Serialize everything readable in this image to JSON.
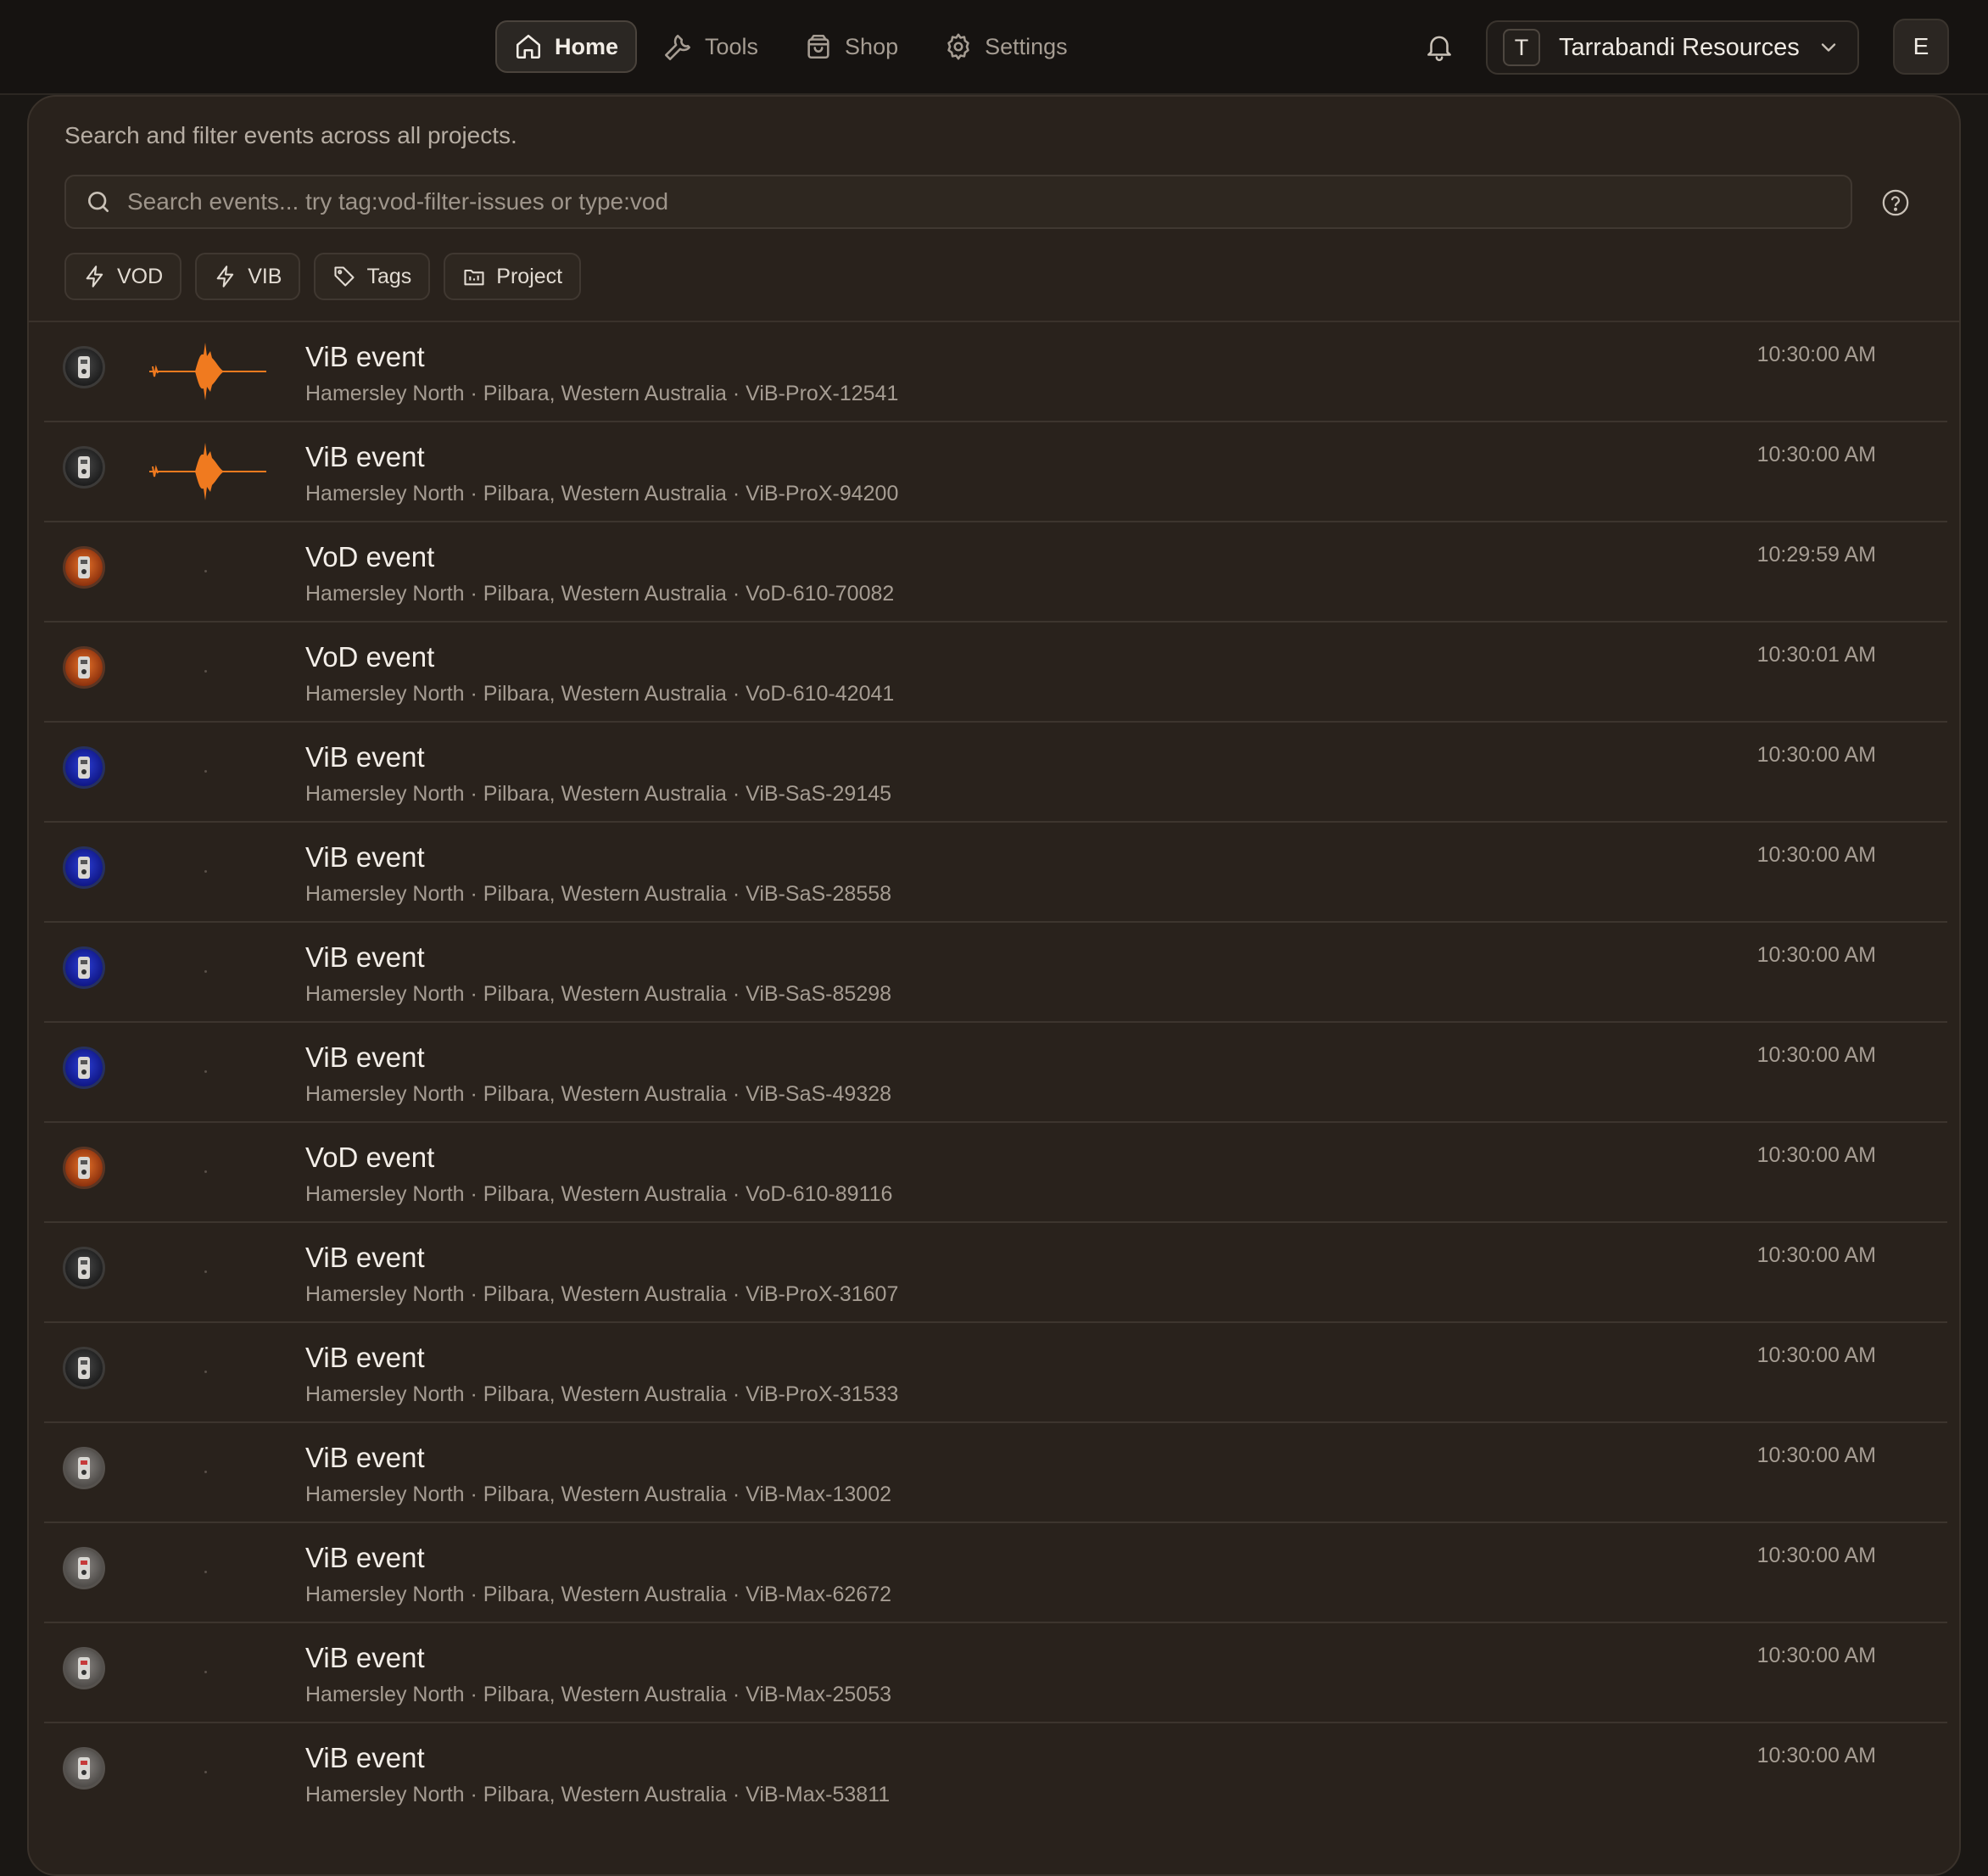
{
  "nav": {
    "items": [
      {
        "label": "Home",
        "icon": "home-icon",
        "active": true
      },
      {
        "label": "Tools",
        "icon": "wrench-icon",
        "active": false
      },
      {
        "label": "Shop",
        "icon": "shopping-bag-icon",
        "active": false
      },
      {
        "label": "Settings",
        "icon": "gear-icon",
        "active": false
      }
    ]
  },
  "org": {
    "initial": "T",
    "name": "Tarrabandi Resources"
  },
  "user": {
    "initial": "E"
  },
  "panel": {
    "subtitle": "Search and filter events across all projects.",
    "search_placeholder": "Search events... try tag:vod-filter-issues or type:vod"
  },
  "filters": [
    {
      "label": "VOD",
      "icon": "lightning-icon"
    },
    {
      "label": "VIB",
      "icon": "lightning-icon"
    },
    {
      "label": "Tags",
      "icon": "tag-icon"
    },
    {
      "label": "Project",
      "icon": "project-icon"
    }
  ],
  "colors": {
    "waveform": "#f07a1f",
    "background": "#1a1714",
    "panel": "#29221c"
  },
  "events": [
    {
      "title": "ViB event",
      "subtitle": "Hamersley North · Pilbara, Western Australia · ViB-ProX-12541",
      "time": "10:30:00 AM",
      "device": "black",
      "waveform": true
    },
    {
      "title": "ViB event",
      "subtitle": "Hamersley North · Pilbara, Western Australia · ViB-ProX-94200",
      "time": "10:30:00 AM",
      "device": "black",
      "waveform": true
    },
    {
      "title": "VoD event",
      "subtitle": "Hamersley North · Pilbara, Western Australia · VoD-610-70082",
      "time": "10:29:59 AM",
      "device": "orange",
      "waveform": false
    },
    {
      "title": "VoD event",
      "subtitle": "Hamersley North · Pilbara, Western Australia · VoD-610-42041",
      "time": "10:30:01 AM",
      "device": "orange",
      "waveform": false
    },
    {
      "title": "ViB event",
      "subtitle": "Hamersley North · Pilbara, Western Australia · ViB-SaS-29145",
      "time": "10:30:00 AM",
      "device": "blue",
      "waveform": false
    },
    {
      "title": "ViB event",
      "subtitle": "Hamersley North · Pilbara, Western Australia · ViB-SaS-28558",
      "time": "10:30:00 AM",
      "device": "blue",
      "waveform": false
    },
    {
      "title": "ViB event",
      "subtitle": "Hamersley North · Pilbara, Western Australia · ViB-SaS-85298",
      "time": "10:30:00 AM",
      "device": "blue",
      "waveform": false
    },
    {
      "title": "ViB event",
      "subtitle": "Hamersley North · Pilbara, Western Australia · ViB-SaS-49328",
      "time": "10:30:00 AM",
      "device": "blue",
      "waveform": false
    },
    {
      "title": "VoD event",
      "subtitle": "Hamersley North · Pilbara, Western Australia · VoD-610-89116",
      "time": "10:30:00 AM",
      "device": "orange",
      "waveform": false
    },
    {
      "title": "ViB event",
      "subtitle": "Hamersley North · Pilbara, Western Australia · ViB-ProX-31607",
      "time": "10:30:00 AM",
      "device": "black",
      "waveform": false
    },
    {
      "title": "ViB event",
      "subtitle": "Hamersley North · Pilbara, Western Australia · ViB-ProX-31533",
      "time": "10:30:00 AM",
      "device": "black",
      "waveform": false
    },
    {
      "title": "ViB event",
      "subtitle": "Hamersley North · Pilbara, Western Australia · ViB-Max-13002",
      "time": "10:30:00 AM",
      "device": "grey",
      "waveform": false
    },
    {
      "title": "ViB event",
      "subtitle": "Hamersley North · Pilbara, Western Australia · ViB-Max-62672",
      "time": "10:30:00 AM",
      "device": "grey",
      "waveform": false
    },
    {
      "title": "ViB event",
      "subtitle": "Hamersley North · Pilbara, Western Australia · ViB-Max-25053",
      "time": "10:30:00 AM",
      "device": "grey",
      "waveform": false
    },
    {
      "title": "ViB event",
      "subtitle": "Hamersley North · Pilbara, Western Australia · ViB-Max-53811",
      "time": "10:30:00 AM",
      "device": "grey",
      "waveform": false
    }
  ]
}
